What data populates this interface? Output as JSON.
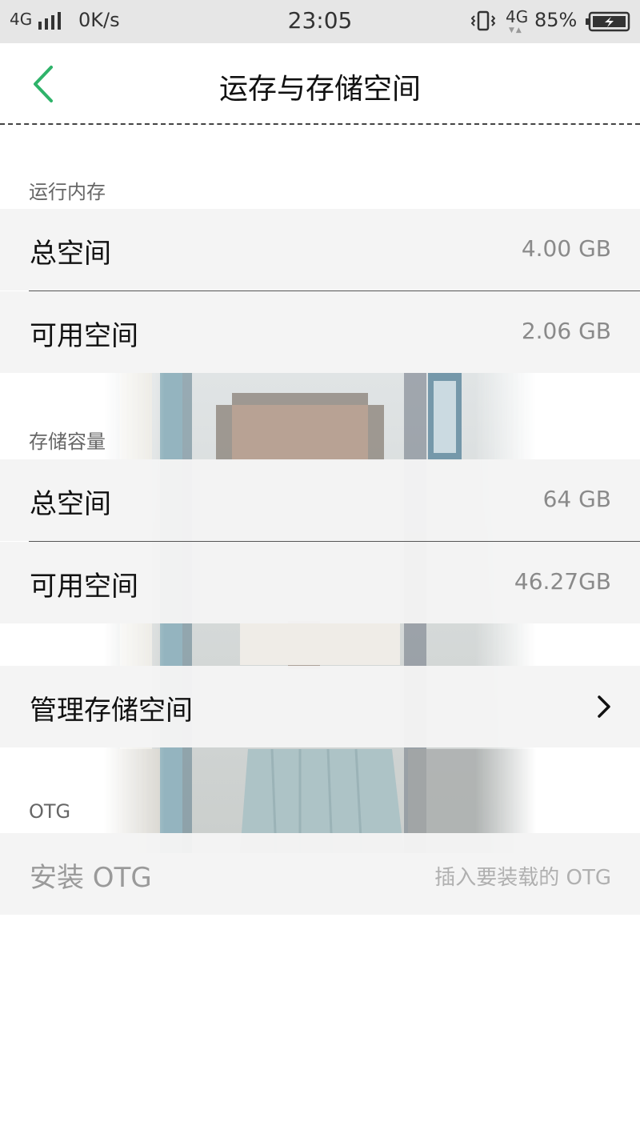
{
  "status_bar": {
    "network_left": "4G",
    "speed": "0K/s",
    "time": "23:05",
    "network_right": "4G",
    "battery": "85%"
  },
  "header": {
    "title": "运存与存储空间"
  },
  "ram": {
    "section_title": "运行内存",
    "rows": [
      {
        "label": "总空间",
        "value": "4.00 GB"
      },
      {
        "label": "可用空间",
        "value": "2.06 GB"
      }
    ]
  },
  "storage": {
    "section_title": "存储容量",
    "rows": [
      {
        "label": "总空间",
        "value": "64 GB"
      },
      {
        "label": "可用空间",
        "value": "46.27GB"
      }
    ]
  },
  "manage": {
    "label": "管理存储空间"
  },
  "otg": {
    "section_title": "OTG",
    "install_label": "安装 OTG",
    "install_hint": "插入要装载的 OTG"
  },
  "icons": {
    "back": "chevron-left-icon",
    "chevron": "chevron-right-icon",
    "signal": "signal-bars-icon",
    "vibrate": "vibrate-icon",
    "battery": "battery-charging-icon"
  },
  "colors": {
    "accent": "#2fb36a",
    "row_bg": "#f4f4f4",
    "status_bg": "#e6e6e6"
  }
}
